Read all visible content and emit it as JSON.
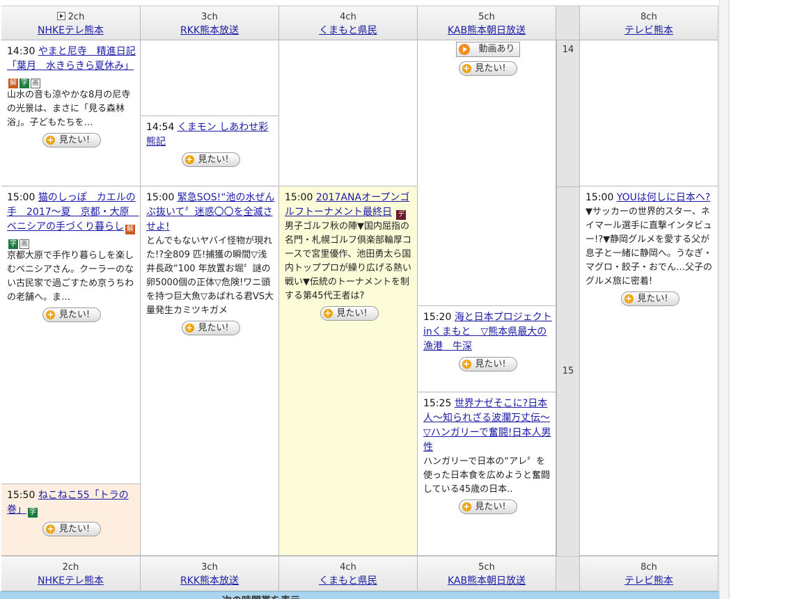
{
  "channels": [
    {
      "ch": "2ch",
      "name": "NHKEテレ熊本",
      "has_icon": true
    },
    {
      "ch": "3ch",
      "name": "RKK熊本放送"
    },
    {
      "ch": "4ch",
      "name": "くまもと県民"
    },
    {
      "ch": "5ch",
      "name": "KAB熊本朝日放送"
    },
    {
      "ch": "8ch",
      "name": "テレビ熊本"
    }
  ],
  "hours": [
    "14",
    "15"
  ],
  "want_label": "見たい!",
  "video_label": "動画あり",
  "programs": {
    "p2a": {
      "time": "14:30",
      "title": "やまと尼寺　精進日記「葉月　水きらきら夏休み」",
      "desc": "山水の音も涼やかな8月の尼寺の光景は、まさに「見る森林浴」。子どもたちを…"
    },
    "p2b": {
      "time": "15:00",
      "title": "猫のしっぽ　カエルの手　2017～夏　京都・大原　ベニシアの手づくり暮らし",
      "desc": "京都大原で手作り暮らしを楽しむベニシアさん。クーラーのない古民家で過ごすため京うちわの老舗へ。ま…"
    },
    "p2c": {
      "time": "15:50",
      "title": "ねこねこ55「トラの巻」"
    },
    "p3a": {
      "time": "14:54",
      "title": "くまモン しあわせ彩熊記"
    },
    "p3b": {
      "time": "15:00",
      "title": "緊急SOS!“池の水ぜんぶ抜いて〞迷惑〇〇を全滅させよ!",
      "desc": "とんでもないヤバイ怪物が現れた!?全809 匹!捕獲の瞬間▽浅井長政“100 年放置お堀〞謎の卵5000個の正体▽危険!ワニ頭を持つ巨大魚▽あばれる君VS大量発生カミツキガメ"
    },
    "p4a": {
      "time": "15:00",
      "title": "2017ANAオープンゴルフトーナメント最終日",
      "desc": "男子ゴルフ秋の陣▼国内屈指の名門・札幌ゴルフ倶楽部輪厚コースで宮里優作、池田勇太ら国内トッププロが繰り広げる熱い戦い▼伝統のトーナメントを制する第45代王者は?"
    },
    "p5b": {
      "time": "15:20",
      "title": "海と日本プロジェクトinくまもと　▽熊本県最大の漁港　牛深"
    },
    "p5c": {
      "time": "15:25",
      "title": "世界ナゼそこに?日本人～知られざる波瀾万丈伝～▽ハンガリーで奮闘!日本人男性",
      "desc": "ハンガリーで日本の“アレ〞を使った日本食を広めようと奮闘している45歳の日本.."
    },
    "p8a": {
      "time": "15:00",
      "title": "YOUは何しに日本へ?",
      "desc": "▼サッカーの世界的スター、ネイマール選手に直撃インタビュー!?▼静岡グルメを愛する父が息子と一緒に静岡へ。うなぎ・マグロ・餃子・おでん…父子のグルメ旅に密着!"
    }
  },
  "badges": {
    "kai": "解",
    "ji": "字",
    "ga": "画",
    "ji2": "デ"
  },
  "bottom_text": "一次の時間帯を表示"
}
